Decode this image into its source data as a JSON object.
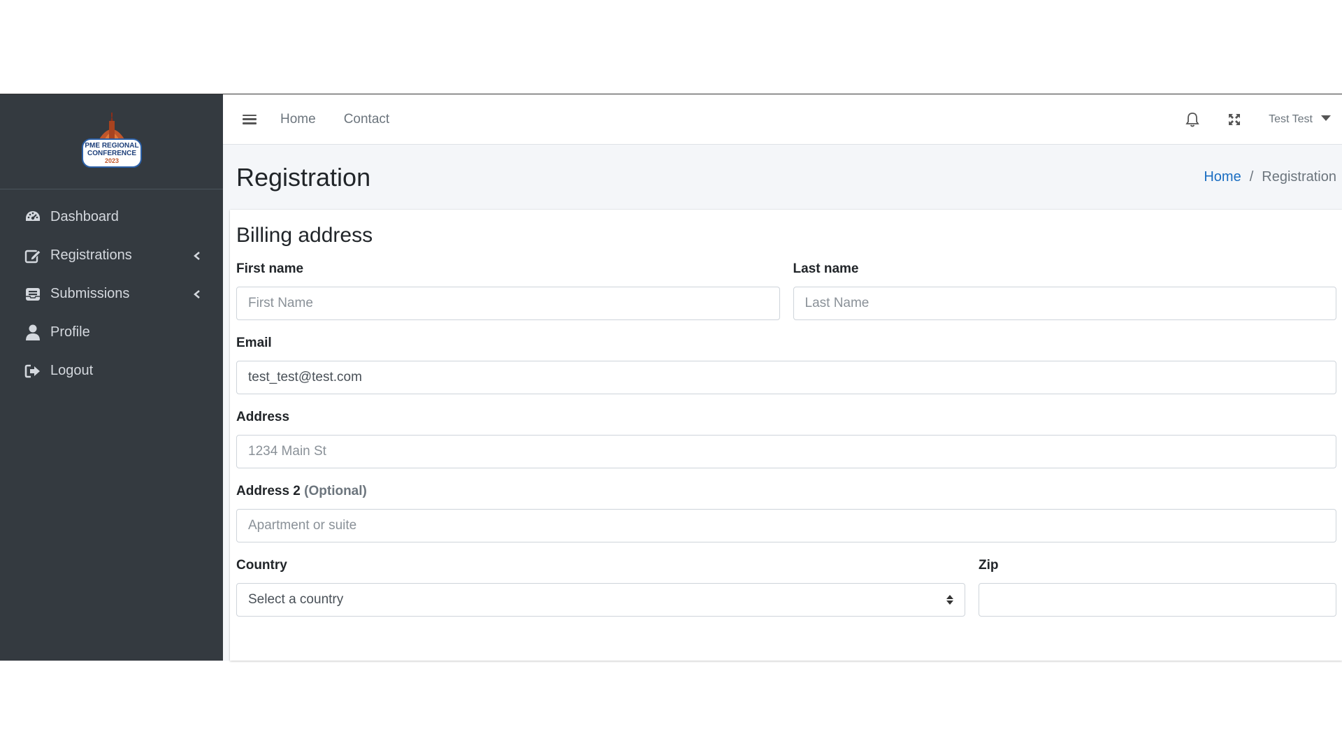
{
  "sidebar": {
    "logo": {
      "lines": [
        "PME REGIONAL",
        "CONFERENCE",
        "2023"
      ]
    },
    "items": [
      {
        "label": "Dashboard",
        "icon": "gauge-icon",
        "has_chevron": false
      },
      {
        "label": "Registrations",
        "icon": "edit-icon",
        "has_chevron": true
      },
      {
        "label": "Submissions",
        "icon": "inbox-icon",
        "has_chevron": true
      },
      {
        "label": "Profile",
        "icon": "user-icon",
        "has_chevron": false
      },
      {
        "label": "Logout",
        "icon": "sign-out-icon",
        "has_chevron": false
      }
    ]
  },
  "navbar": {
    "links": [
      "Home",
      "Contact"
    ],
    "user_name": "Test Test"
  },
  "header": {
    "title": "Registration",
    "breadcrumb": {
      "home": "Home",
      "separator": "/",
      "current": "Registration"
    }
  },
  "form": {
    "title": "Billing address",
    "first_name": {
      "label": "First name",
      "placeholder": "First Name",
      "value": ""
    },
    "last_name": {
      "label": "Last name",
      "placeholder": "Last Name",
      "value": ""
    },
    "email": {
      "label": "Email",
      "placeholder": "",
      "value": "test_test@test.com"
    },
    "address": {
      "label": "Address",
      "placeholder": "1234 Main St",
      "value": ""
    },
    "address2": {
      "label": "Address 2",
      "optional": "(Optional)",
      "placeholder": "Apartment or suite",
      "value": ""
    },
    "country": {
      "label": "Country",
      "selected": "Select a country"
    },
    "zip": {
      "label": "Zip",
      "placeholder": "",
      "value": ""
    }
  },
  "colors": {
    "sidebar_bg": "#343a40",
    "link_blue": "#1b6ec2",
    "content_bg": "#f4f6f9"
  }
}
